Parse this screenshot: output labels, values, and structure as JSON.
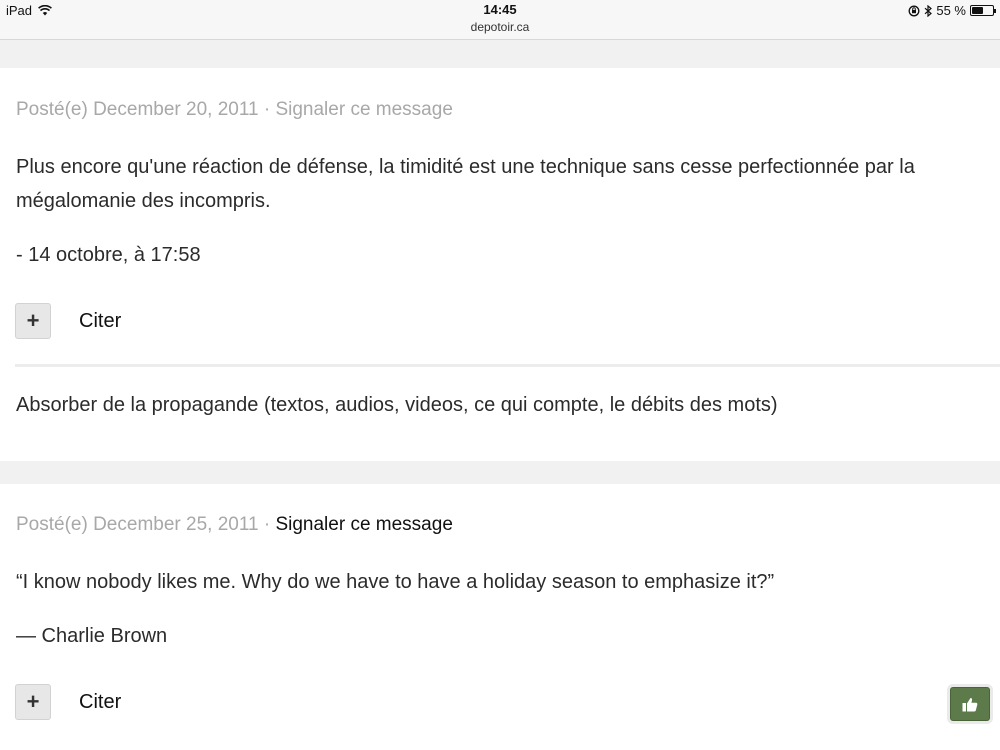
{
  "status_bar": {
    "device": "iPad",
    "time": "14:45",
    "url": "depotoir.ca",
    "battery": "55 %",
    "battery_level": 0.55,
    "icons": [
      "wifi-icon",
      "rotation-lock-icon",
      "bluetooth-icon",
      "battery-icon"
    ]
  },
  "posts": [
    {
      "posted": "Posté(e) December 20, 2011",
      "separator": " · ",
      "report": "Signaler ce message",
      "paragraphs": [
        "Plus encore qu'une réaction de défense, la timidité est une technique sans cesse perfectionnée par la mégalomanie des incompris.",
        "- 14 octobre, à 17:58"
      ],
      "quote_label": "Citer",
      "plus_icon": "+",
      "signature": "Absorber de la propagande (textos, audios, videos, ce qui compte, le débits des mots)"
    },
    {
      "posted": "Posté(e) December 25, 2011",
      "separator": " · ",
      "report": "Signaler ce message",
      "paragraphs": [
        "“I know nobody likes me. Why do we have to have a holiday season to emphasize it?”",
        "— Charlie Brown"
      ],
      "quote_label": "Citer",
      "plus_icon": "+",
      "like_icon": "thumbs-up-icon"
    }
  ],
  "colors": {
    "like_button": "#5c7a4a",
    "meta_text": "#a8a8a8",
    "page_background": "#f1f1f1"
  }
}
